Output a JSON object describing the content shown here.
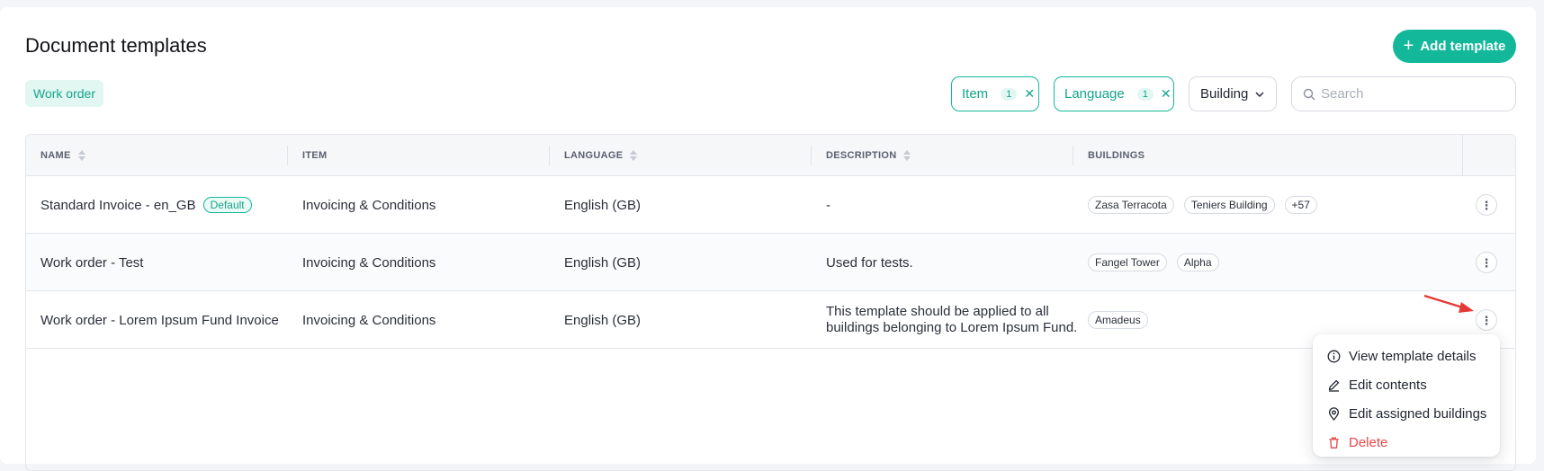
{
  "page": {
    "title": "Document templates",
    "add_button": "Add template",
    "tag": "Work order"
  },
  "filters": {
    "item": {
      "label": "Item",
      "count": "1"
    },
    "language": {
      "label": "Language",
      "count": "1"
    },
    "building": {
      "label": "Building"
    },
    "search": {
      "placeholder": "Search",
      "value": ""
    }
  },
  "table": {
    "headers": {
      "name": "NAME",
      "item": "ITEM",
      "language": "LANGUAGE",
      "description": "DESCRIPTION",
      "buildings": "BUILDINGS"
    },
    "rows": [
      {
        "name": "Standard Invoice - en_GB",
        "badge": "Default",
        "item": "Invoicing & Conditions",
        "language": "English (GB)",
        "description": "-",
        "buildings": [
          "Zasa Terracota",
          "Teniers Building",
          "+57"
        ]
      },
      {
        "name": "Work order - Test",
        "item": "Invoicing & Conditions",
        "language": "English (GB)",
        "description": "Used for tests.",
        "buildings": [
          "Fangel Tower",
          "Alpha"
        ]
      },
      {
        "name": "Work order - Lorem Ipsum Fund Invoice",
        "item": "Invoicing & Conditions",
        "language": "English (GB)",
        "description": "This template should be applied to all buildings belonging to Lorem Ipsum Fund.",
        "buildings": [
          "Amadeus"
        ]
      }
    ]
  },
  "menu": {
    "items": [
      {
        "label": "View template details",
        "icon": "info-icon"
      },
      {
        "label": "Edit contents",
        "icon": "pen-icon"
      },
      {
        "label": "Edit assigned buildings",
        "icon": "location-pin-icon"
      },
      {
        "label": "Delete",
        "icon": "trash-icon"
      }
    ]
  },
  "colors": {
    "accent": "#13b89a",
    "danger": "#e5484d",
    "annotation_arrow": "#e53935"
  }
}
